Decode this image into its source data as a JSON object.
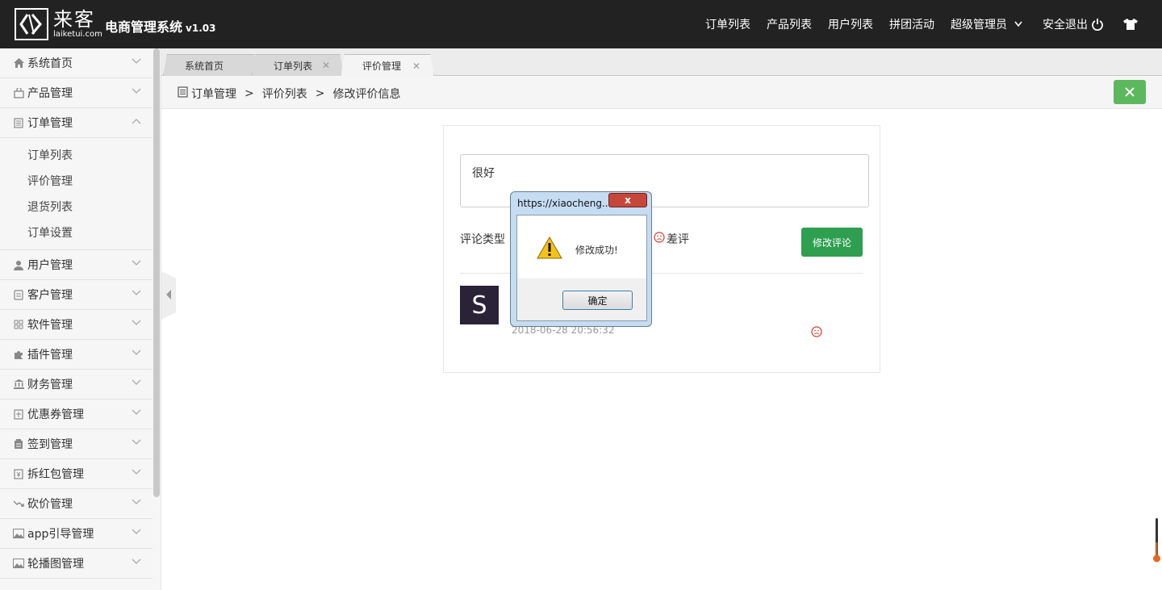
{
  "header": {
    "logo_cn": "来客",
    "logo_en": "laiketui.com",
    "system_title": "电商管理系统",
    "version": "v1.03",
    "nav": [
      "订单列表",
      "产品列表",
      "用户列表",
      "拼团活动"
    ],
    "admin_label": "超级管理员",
    "logout_label": "安全退出",
    "icons": {
      "logout": "power-icon",
      "theme": "tshirt-icon",
      "admin": "chevron-down-icon"
    }
  },
  "sidebar": {
    "items": [
      {
        "label": "系统首页",
        "icon": "home-icon"
      },
      {
        "label": "产品管理",
        "icon": "bag-icon"
      },
      {
        "label": "订单管理",
        "icon": "document-icon",
        "expanded": true
      },
      {
        "label": "用户管理",
        "icon": "user-icon"
      },
      {
        "label": "客户管理",
        "icon": "clipboard-icon"
      },
      {
        "label": "软件管理",
        "icon": "grid-icon"
      },
      {
        "label": "插件管理",
        "icon": "puzzle-icon"
      },
      {
        "label": "财务管理",
        "icon": "bank-icon"
      },
      {
        "label": "优惠券管理",
        "icon": "coupon-icon"
      },
      {
        "label": "签到管理",
        "icon": "clipboard-check-icon"
      },
      {
        "label": "拆红包管理",
        "icon": "envelope-icon"
      },
      {
        "label": "砍价管理",
        "icon": "trend-icon"
      },
      {
        "label": "app引导管理",
        "icon": "image-icon"
      },
      {
        "label": "轮播图管理",
        "icon": "picture-icon"
      }
    ],
    "submenu": [
      "订单列表",
      "评价管理",
      "退货列表",
      "订单设置"
    ]
  },
  "tabs": [
    {
      "label": "系统首页",
      "closable": false
    },
    {
      "label": "订单列表",
      "closable": true
    },
    {
      "label": "评价管理",
      "closable": true,
      "active": true
    }
  ],
  "breadcrumb": {
    "items": [
      "订单管理",
      "评价列表",
      "修改评价信息"
    ],
    "separator": ">"
  },
  "form": {
    "comment_value": "很好",
    "type_label": "评论类型",
    "bad_label": "差评",
    "submit_label": "修改评论",
    "avatar_letter": "S",
    "timestamp": "2018-06-28 20:56:32"
  },
  "dialog": {
    "title": "https://xiaocheng...",
    "message": "修改成功!",
    "ok_label": "确定",
    "close_label": "x",
    "icon": "warning-icon"
  },
  "colors": {
    "header_bg": "#222222",
    "primary_green": "#2e9e4f",
    "close_green": "#5cb85c",
    "bad_red": "#d9392b"
  }
}
